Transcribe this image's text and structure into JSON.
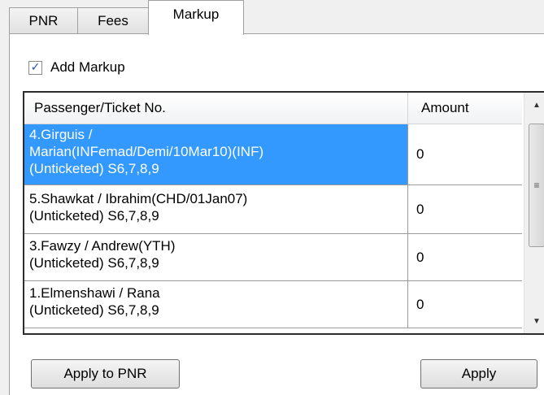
{
  "tabs": [
    {
      "label": "PNR",
      "active": false
    },
    {
      "label": "Fees",
      "active": false
    },
    {
      "label": "Markup",
      "active": true
    }
  ],
  "add_markup": {
    "label": "Add Markup",
    "checked": true
  },
  "grid": {
    "columns": [
      "Passenger/Ticket No.",
      "Amount"
    ],
    "rows": [
      {
        "lines": [
          "4.Girguis /",
          "Marian(INFemad/Demi/10Mar10)(INF)",
          "(Unticketed) S6,7,8,9"
        ],
        "amount": "0",
        "selected": true
      },
      {
        "lines": [
          "5.Shawkat / Ibrahim(CHD/01Jan07)",
          "(Unticketed) S6,7,8,9"
        ],
        "amount": "0",
        "selected": false
      },
      {
        "lines": [
          "3.Fawzy / Andrew(YTH)",
          "(Unticketed) S6,7,8,9"
        ],
        "amount": "0",
        "selected": false
      },
      {
        "lines": [
          "1.Elmenshawi / Rana",
          "(Unticketed) S6,7,8,9"
        ],
        "amount": "0",
        "selected": false
      }
    ]
  },
  "buttons": {
    "apply_to_pnr": "Apply to PNR",
    "apply": "Apply"
  },
  "colors": {
    "selection": "#3399ff"
  }
}
